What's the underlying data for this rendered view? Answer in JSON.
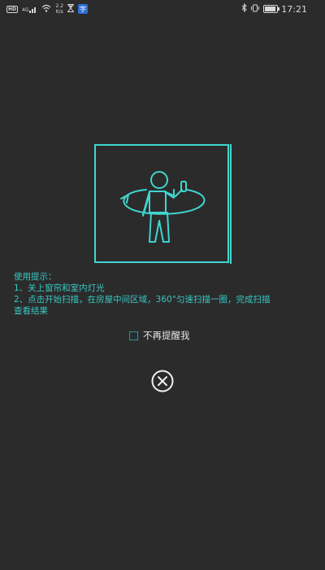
{
  "status_bar": {
    "hd_label": "HD",
    "signal_label": "4G",
    "speed_value": "2.2",
    "speed_unit": "K/s",
    "app_badge": "字",
    "time": "17:21"
  },
  "tips": {
    "heading": "使用提示：",
    "line1": "1、关上窗帘和室内灯光",
    "line2": "2、点击开始扫描，在房屋中间区域，360°匀速扫描一圈，完成扫描",
    "line3": "查看结果"
  },
  "dont_remind": {
    "label": "不再提醒我",
    "checked": false
  },
  "colors": {
    "background": "#2b2b2b",
    "accent": "#3fd6cf",
    "tip_text": "#37c9c4"
  },
  "icons": {
    "scan": "person-rotating-icon",
    "close": "close-icon"
  }
}
